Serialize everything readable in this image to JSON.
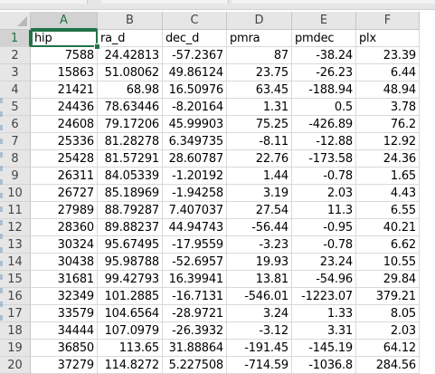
{
  "columns": [
    "A",
    "B",
    "C",
    "D",
    "E",
    "F"
  ],
  "rows": [
    {
      "n": "1",
      "cells": [
        "hip",
        "ra_d",
        "dec_d",
        "pmra",
        "pmdec",
        "plx"
      ]
    },
    {
      "n": "2",
      "cells": [
        "7588",
        "24.42813",
        "-57.2367",
        "87",
        "-38.24",
        "23.39"
      ]
    },
    {
      "n": "3",
      "cells": [
        "15863",
        "51.08062",
        "49.86124",
        "23.75",
        "-26.23",
        "6.44"
      ]
    },
    {
      "n": "4",
      "cells": [
        "21421",
        "68.98",
        "16.50976",
        "63.45",
        "-188.94",
        "48.94"
      ]
    },
    {
      "n": "5",
      "cells": [
        "24436",
        "78.63446",
        "-8.20164",
        "1.31",
        "0.5",
        "3.78"
      ]
    },
    {
      "n": "6",
      "cells": [
        "24608",
        "79.17206",
        "45.99903",
        "75.25",
        "-426.89",
        "76.2"
      ]
    },
    {
      "n": "7",
      "cells": [
        "25336",
        "81.28278",
        "6.349735",
        "-8.11",
        "-12.88",
        "12.92"
      ]
    },
    {
      "n": "8",
      "cells": [
        "25428",
        "81.57291",
        "28.60787",
        "22.76",
        "-173.58",
        "24.36"
      ]
    },
    {
      "n": "9",
      "cells": [
        "26311",
        "84.05339",
        "-1.20192",
        "1.44",
        "-0.78",
        "1.65"
      ]
    },
    {
      "n": "10",
      "cells": [
        "26727",
        "85.18969",
        "-1.94258",
        "3.19",
        "2.03",
        "4.43"
      ]
    },
    {
      "n": "11",
      "cells": [
        "27989",
        "88.79287",
        "7.407037",
        "27.54",
        "11.3",
        "6.55"
      ]
    },
    {
      "n": "12",
      "cells": [
        "28360",
        "89.88237",
        "44.94743",
        "-56.44",
        "-0.95",
        "40.21"
      ]
    },
    {
      "n": "13",
      "cells": [
        "30324",
        "95.67495",
        "-17.9559",
        "-3.23",
        "-0.78",
        "6.62"
      ]
    },
    {
      "n": "14",
      "cells": [
        "30438",
        "95.98788",
        "-52.6957",
        "19.93",
        "23.24",
        "10.55"
      ]
    },
    {
      "n": "15",
      "cells": [
        "31681",
        "99.42793",
        "16.39941",
        "13.81",
        "-54.96",
        "29.84"
      ]
    },
    {
      "n": "16",
      "cells": [
        "32349",
        "101.2885",
        "-16.7131",
        "-546.01",
        "-1223.07",
        "379.21"
      ]
    },
    {
      "n": "17",
      "cells": [
        "33579",
        "104.6564",
        "-28.9721",
        "3.24",
        "1.33",
        "8.05"
      ]
    },
    {
      "n": "18",
      "cells": [
        "34444",
        "107.0979",
        "-26.3932",
        "-3.12",
        "3.31",
        "2.03"
      ]
    },
    {
      "n": "19",
      "cells": [
        "36850",
        "113.65",
        "31.88864",
        "-191.45",
        "-145.19",
        "64.12"
      ]
    },
    {
      "n": "20",
      "cells": [
        "37279",
        "114.8272",
        "5.227508",
        "-714.59",
        "-1036.8",
        "284.56"
      ]
    }
  ]
}
